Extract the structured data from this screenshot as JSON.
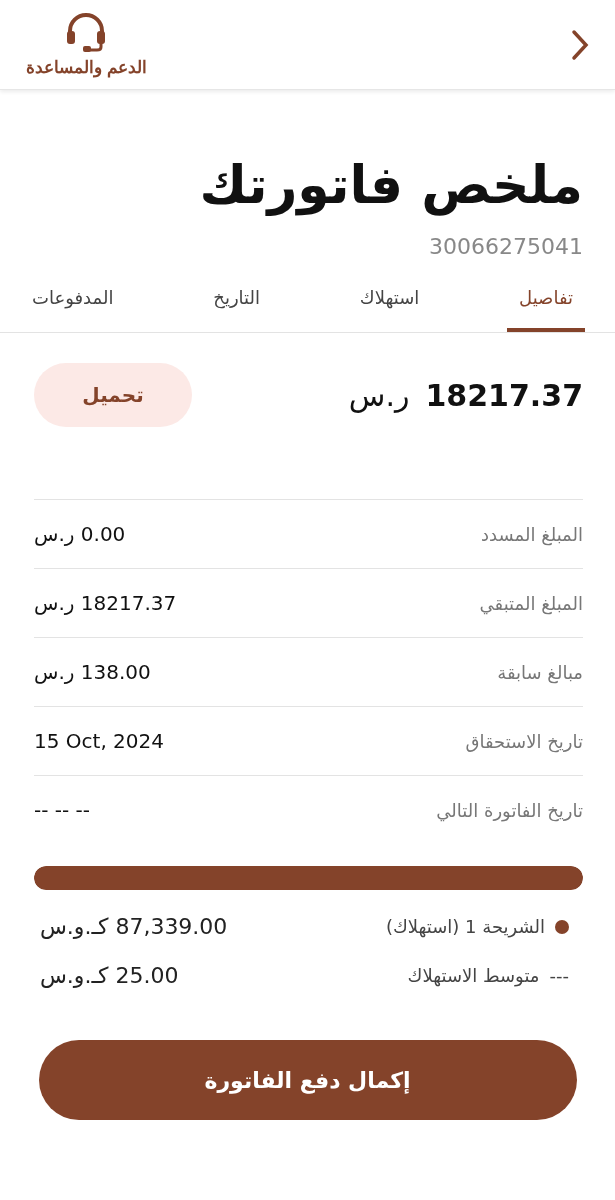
{
  "header": {
    "support_label": "الدعم والمساعدة"
  },
  "title": "ملخص فاتورتك",
  "account_number": "30066275041",
  "tabs": [
    {
      "label": "تفاصيل",
      "selected": true
    },
    {
      "label": "استهلاك",
      "selected": false
    },
    {
      "label": "التاريخ",
      "selected": false
    },
    {
      "label": "المدفوعات",
      "selected": false
    }
  ],
  "total": {
    "amount": "18217.37",
    "currency": "ر.س"
  },
  "download_button": "تحميل",
  "details": [
    {
      "label": "المبلغ المسدد",
      "value": "0.00 ر.س"
    },
    {
      "label": "المبلغ المتبقي",
      "value": "18217.37 ر.س"
    },
    {
      "label": "مبالغ سابقة",
      "value": "138.00 ر.س"
    },
    {
      "label": "تاريخ الاستحقاق",
      "value": "15 Oct, 2024"
    },
    {
      "label": "تاريخ الفاتورة التالي",
      "value": "-- -- --"
    }
  ],
  "usage": {
    "level": 1,
    "legend": [
      {
        "kind": "dot",
        "color": "#84432a",
        "label": "الشريحة 1 (استهلاك)",
        "value": "87,339.00 كـ.و.س"
      },
      {
        "kind": "dash",
        "marker": "---",
        "label": "متوسط الاستهلاك",
        "value": "25.00 كـ.و.س"
      }
    ]
  },
  "pay_button": "إكمال دفع الفاتورة"
}
